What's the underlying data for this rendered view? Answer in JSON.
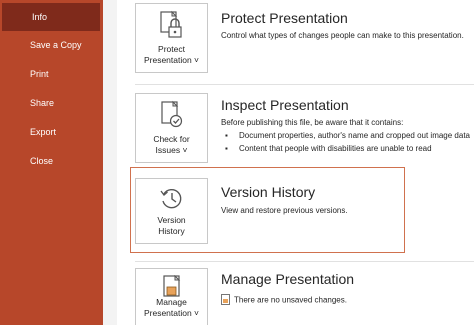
{
  "sidebar": {
    "items": [
      {
        "label": "Info"
      },
      {
        "label": "Save a Copy"
      },
      {
        "label": "Print"
      },
      {
        "label": "Share"
      },
      {
        "label": "Export"
      },
      {
        "label": "Close"
      }
    ]
  },
  "sections": {
    "protect": {
      "title": "Protect Presentation",
      "desc": "Control what types of changes people can make to this presentation.",
      "button_line1": "Protect",
      "button_line2": "Presentation ˅"
    },
    "inspect": {
      "title": "Inspect Presentation",
      "desc": "Before publishing this file, be aware that it contains:",
      "bullets": [
        "Document properties, author's name and cropped out image data",
        "Content that people with disabilities are unable to read"
      ],
      "button_line1": "Check for",
      "button_line2": "Issues ˅"
    },
    "version": {
      "title": "Version History",
      "desc": "View and restore previous versions.",
      "button_line1": "Version",
      "button_line2": "History"
    },
    "manage": {
      "title": "Manage Presentation",
      "desc": "There are no unsaved changes.",
      "button_line1": "Manage",
      "button_line2": "Presentation ˅"
    }
  },
  "colors": {
    "sidebar": "#b7472a",
    "active": "#7f2a1b",
    "highlight": "#d0714e"
  }
}
